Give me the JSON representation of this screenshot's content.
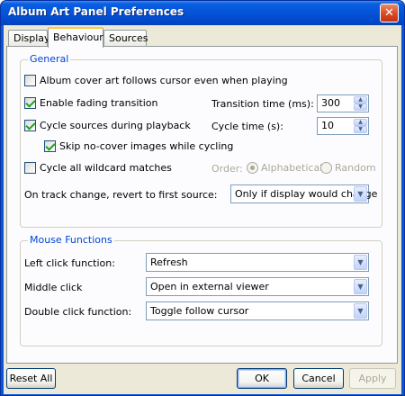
{
  "window": {
    "title": "Album Art Panel Preferences"
  },
  "tabs": [
    {
      "label": "Display"
    },
    {
      "label": "Behaviour"
    },
    {
      "label": "Sources"
    }
  ],
  "general": {
    "title": "General",
    "follow_cursor": {
      "label": "Album cover art follows cursor even when playing",
      "checked": false
    },
    "fading": {
      "label": "Enable fading transition",
      "checked": true
    },
    "transition_time_label": "Transition time (ms):",
    "transition_time_value": "300",
    "cycle_sources": {
      "label": "Cycle sources during playback",
      "checked": true
    },
    "cycle_time_label": "Cycle time (s):",
    "cycle_time_value": "10",
    "skip_nocover": {
      "label": "Skip no-cover images while cycling",
      "checked": true
    },
    "cycle_wildcard": {
      "label": "Cycle all wildcard matches",
      "checked": false
    },
    "order_label": "Order:",
    "order_alpha": "Alphabetical",
    "order_random": "Random",
    "order_selected": "Alphabetical",
    "revert_label": "On track change, revert to first source:",
    "revert_value": "Only if display would change"
  },
  "mouse": {
    "title": "Mouse Functions",
    "left_label": "Left click function:",
    "left_value": "Refresh",
    "middle_label": "Middle click",
    "middle_value": "Open in external viewer",
    "double_label": "Double click function:",
    "double_value": "Toggle follow cursor"
  },
  "buttons": {
    "reset": "Reset All",
    "ok": "OK",
    "cancel": "Cancel",
    "apply": "Apply"
  }
}
